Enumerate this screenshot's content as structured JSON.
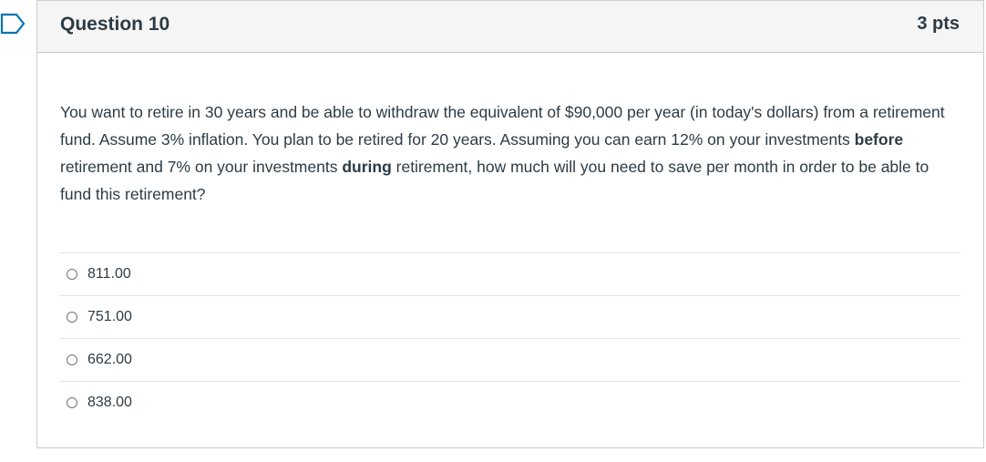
{
  "question": {
    "title": "Question 10",
    "points": "3 pts",
    "text_parts": [
      "You want to retire in 30 years and be able to withdraw the equivalent of $90,000 per year (in today's dollars) from a retirement fund. Assume 3% inflation. You plan to be retired for 20 years. Assuming you can earn 12% on your investments ",
      "before",
      " retirement and 7% on your investments ",
      "during",
      " retirement, how much will you need to save per month in order to be able to fund this retirement?"
    ]
  },
  "answers": [
    {
      "label": "811.00"
    },
    {
      "label": "751.00"
    },
    {
      "label": "662.00"
    },
    {
      "label": "838.00"
    }
  ],
  "icons": {
    "flag": "flag-question-icon"
  },
  "colors": {
    "accent": "#0374b5",
    "text": "#2d3b45",
    "header_bg": "#f5f5f5",
    "border": "#c7cdd1"
  }
}
